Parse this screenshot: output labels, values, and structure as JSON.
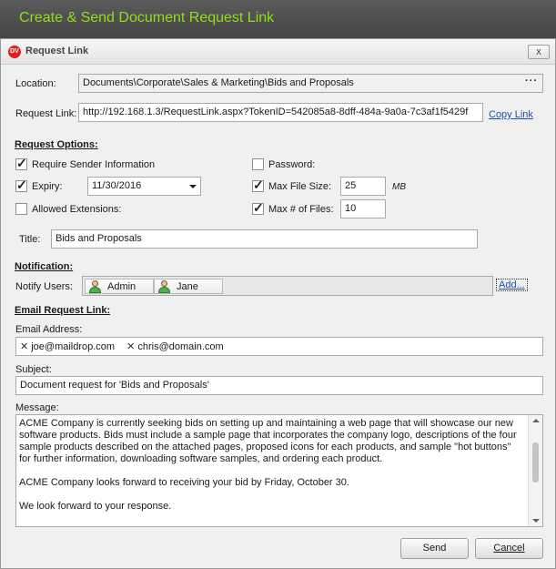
{
  "banner": {
    "title": "Create & Send Document Request Link"
  },
  "window": {
    "title": "Request Link",
    "close_label": "x",
    "app_icon_text": "DV"
  },
  "location": {
    "label": "Location:",
    "value": "Documents\\Corporate\\Sales & Marketing\\Bids and Proposals",
    "browse_label": "···"
  },
  "request_link": {
    "label": "Request Link:",
    "value": "http://192.168.1.3/RequestLink.aspx?TokenID=542085a8-8dff-484a-9a0a-7c3af1f5429f",
    "copy_label": "Copy Link"
  },
  "options": {
    "heading": "Request Options:",
    "require_sender": {
      "label": "Require Sender Information",
      "checked": true
    },
    "password": {
      "label": "Password:",
      "checked": false
    },
    "expiry": {
      "label": "Expiry:",
      "checked": true,
      "value": "11/30/2016"
    },
    "max_file_size": {
      "label": "Max File Size:",
      "checked": true,
      "value": "25",
      "unit": "MB"
    },
    "allowed_ext": {
      "label": "Allowed Extensions:",
      "checked": false
    },
    "max_files": {
      "label": "Max # of Files:",
      "checked": true,
      "value": "10"
    }
  },
  "title_field": {
    "label": "Title:",
    "value": "Bids and Proposals"
  },
  "notification": {
    "heading": "Notification:",
    "label": "Notify Users:",
    "users": [
      "Admin",
      "Jane"
    ],
    "add_label": "Add..."
  },
  "email": {
    "heading": "Email Request Link:",
    "address_label": "Email Address:",
    "addresses": [
      "joe@maildrop.com",
      "chris@domain.com"
    ],
    "subject_label": "Subject:",
    "subject": "Document request for 'Bids and Proposals'",
    "message_label": "Message:",
    "message_paragraphs": [
      "ACME Company is currently seeking bids on setting up and maintaining a web page that will showcase our new software products. Bids must include a sample page that incorporates the company logo, descriptions of the four sample products described on the attached pages, proposed icons for each products, and sample \"hot buttons\" for further information, downloading software samples, and ordering each product.",
      "ACME Company looks forward to receiving your bid by Friday, October 30.",
      "We look forward to your response."
    ]
  },
  "buttons": {
    "send": "Send",
    "cancel": "Cancel"
  }
}
